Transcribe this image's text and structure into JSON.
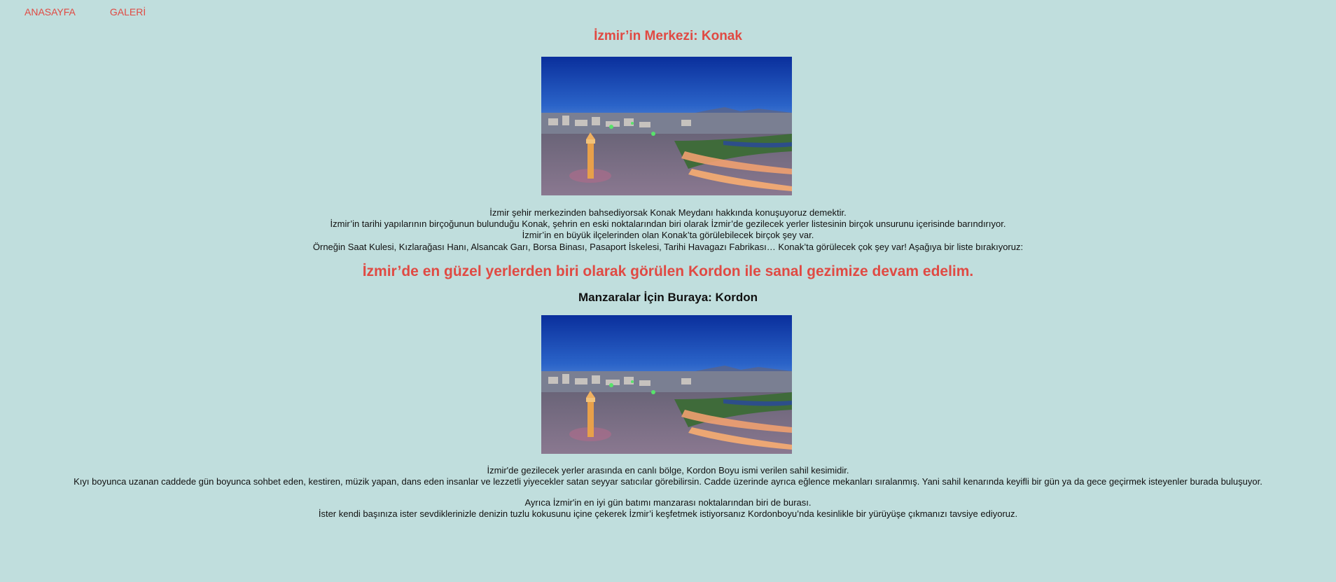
{
  "nav": {
    "home": "ANASAYFA",
    "gallery": "GALERİ"
  },
  "section1": {
    "title": "İzmir’in Merkezi: Konak",
    "lines": [
      "İzmir şehir merkezinden bahsediyorsak Konak Meydanı hakkında konuşuyoruz demektir.",
      "İzmir’in tarihi yapılarının birçoğunun bulunduğu Konak, şehrin en eski noktalarından biri olarak İzmir’de gezilecek yerler listesinin birçok unsurunu içerisinde barındırıyor.",
      "İzmir’in en büyük ilçelerinden olan Konak’ta görülebilecek birçok şey var.",
      "Örneğin Saat Kulesi, Kızlarağası Hanı, Alsancak Garı, Borsa Binası, Pasaport İskelesi, Tarihi Havagazı Fabrikası… Konak’ta görülecek çok şey var! Aşağıya bir liste bırakıyoruz:"
    ]
  },
  "banner": "İzmir’de en güzel yerlerden biri olarak görülen Kordon ile sanal gezimize devam edelim.",
  "section2": {
    "title": "Manzaralar İçin Buraya: Kordon",
    "lines_a": [
      "İzmir'de gezilecek yerler arasında en canlı bölge, Kordon Boyu ismi verilen sahil kesimidir.",
      "Kıyı boyunca uzanan caddede gün boyunca sohbet eden, kestiren, müzik yapan, dans eden insanlar ve lezzetli yiyecekler satan seyyar satıcılar görebilirsin. Cadde üzerinde ayrıca eğlence mekanları sıralanmış. Yani sahil kenarında keyifli bir gün ya da gece geçirmek isteyenler burada buluşuyor."
    ],
    "lines_b": [
      "Ayrıca İzmir'in en iyi gün batımı manzarası noktalarından biri de burası.",
      "İster kendi başınıza ister sevdiklerinizle denizin tuzlu kokusunu içine çekerek İzmir’i keşfetmek istiyorsanız Kordonboyu’nda kesinlikle bir yürüyüşe çıkmanızı tavsiye ediyoruz."
    ]
  },
  "colors": {
    "background": "#c0dedd",
    "accent": "#e04a43"
  }
}
